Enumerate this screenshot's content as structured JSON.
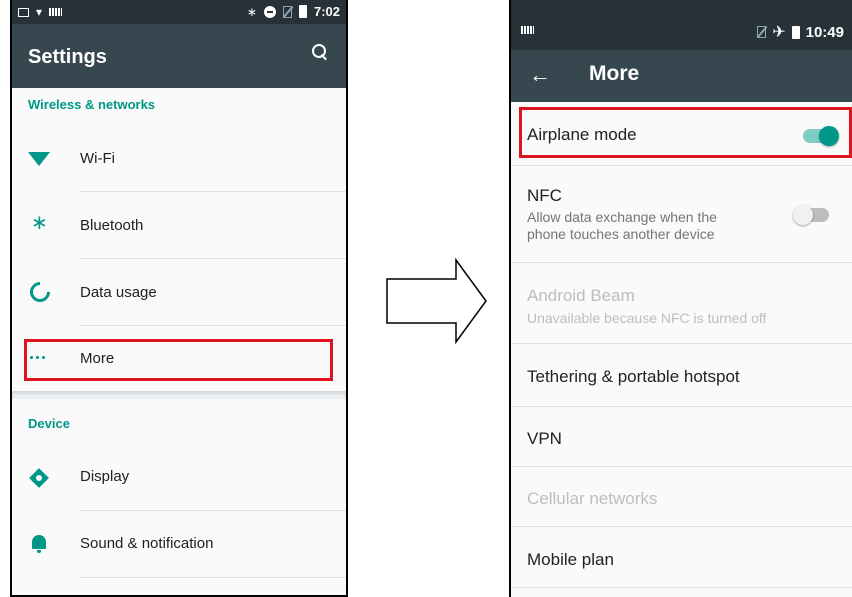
{
  "left_screen": {
    "status_bar": {
      "time": "7:02"
    },
    "toolbar": {
      "title": "Settings"
    },
    "sections": [
      {
        "header": "Wireless & networks",
        "items": [
          {
            "label": "Wi-Fi",
            "icon": "wifi-icon"
          },
          {
            "label": "Bluetooth",
            "icon": "bluetooth-icon"
          },
          {
            "label": "Data usage",
            "icon": "data-usage-icon"
          },
          {
            "label": "More",
            "icon": "more-dots-icon",
            "highlighted": true
          }
        ]
      },
      {
        "header": "Device",
        "items": [
          {
            "label": "Display",
            "icon": "display-icon"
          },
          {
            "label": "Sound & notification",
            "icon": "bell-icon"
          }
        ]
      }
    ]
  },
  "right_screen": {
    "status_bar": {
      "time": "10:49"
    },
    "toolbar": {
      "title": "More"
    },
    "items": [
      {
        "label": "Airplane mode",
        "toggle": "on",
        "highlighted": true
      },
      {
        "label": "NFC",
        "summary": "Allow data exchange when the phone touches another device",
        "toggle": "off"
      },
      {
        "label": "Android Beam",
        "summary": "Unavailable because NFC is turned off",
        "disabled": true
      },
      {
        "label": "Tethering & portable hotspot"
      },
      {
        "label": "VPN"
      },
      {
        "label": "Cellular networks",
        "disabled": true
      },
      {
        "label": "Mobile plan"
      }
    ]
  },
  "colors": {
    "accent": "#009688",
    "highlight_box": "#e0141e",
    "toolbar": "#37474f",
    "status_bar": "#263238"
  }
}
